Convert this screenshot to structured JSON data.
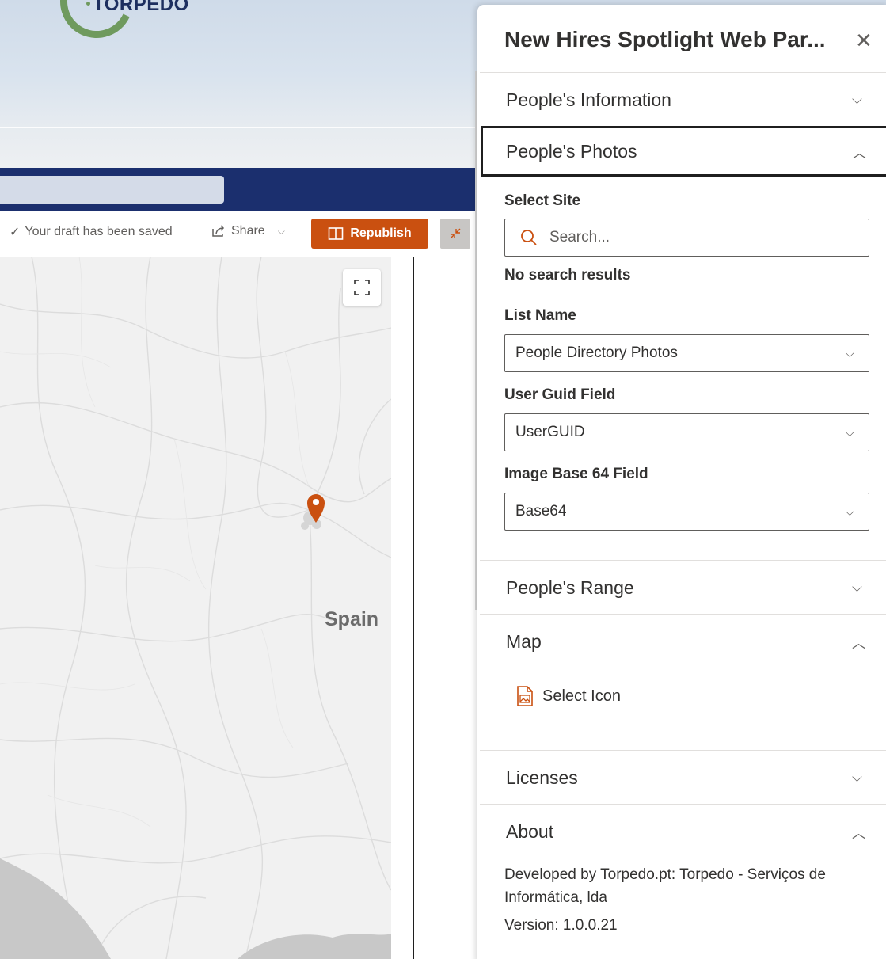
{
  "brand": {
    "name": "TORPEDO"
  },
  "command_bar": {
    "draft_status": "Your draft has been saved",
    "share_label": "Share",
    "republish_label": "Republish"
  },
  "map": {
    "country_label": "Spain",
    "marker_color": "#ca5010"
  },
  "pane": {
    "title": "New Hires Spotlight Web Par...",
    "groups": {
      "people_information": "People's Information",
      "people_photos": "People's Photos",
      "people_range": "People's Range",
      "map": "Map",
      "licenses": "Licenses",
      "about": "About"
    },
    "select_site": {
      "label": "Select Site",
      "placeholder": "Search...",
      "message": "No search results"
    },
    "list_name": {
      "label": "List Name",
      "value": "People Directory Photos"
    },
    "user_guid_field": {
      "label": "User Guid Field",
      "value": "UserGUID"
    },
    "image_base64_field": {
      "label": "Image Base 64 Field",
      "value": "Base64"
    },
    "map_select_icon": "Select Icon",
    "about": {
      "developed_by": "Developed by Torpedo.pt: Torpedo - Serviços de Informática, lda",
      "version": "Version: 1.0.0.21"
    }
  },
  "colors": {
    "accent": "#ca5010",
    "suitebar": "#1b2f6e",
    "logo_green": "#6f9a5e"
  }
}
